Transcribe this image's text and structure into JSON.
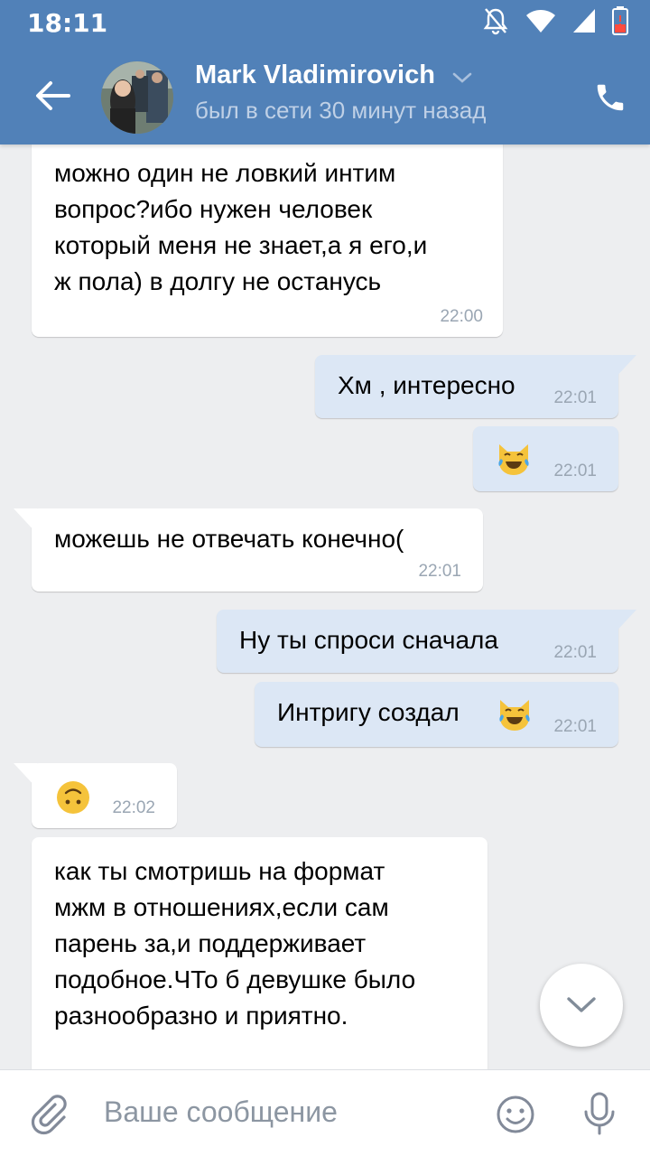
{
  "status_bar": {
    "time": "18:11"
  },
  "header": {
    "contact_name": "Mark Vladimirovich",
    "last_seen": "был в сети 30 минут назад",
    "icons": {
      "back": "back-arrow-icon",
      "call": "phone-icon",
      "dropdown": "chevron-down-icon"
    }
  },
  "messages": [
    {
      "direction": "incoming",
      "text": "можно один не ловкий интим\nвопрос?ибо нужен человек\nкоторый меня не знает,а я его,и\nж пола) в долгу не останусь",
      "time": "22:00"
    },
    {
      "direction": "outgoing",
      "text": "Хм , интересно",
      "time": "22:01"
    },
    {
      "direction": "outgoing",
      "emoji": "cat-tears-of-joy",
      "time": "22:01"
    },
    {
      "direction": "incoming",
      "text": "можешь не отвечать конечно(",
      "time": "22:01"
    },
    {
      "direction": "outgoing",
      "text": "Ну ты спроси сначала",
      "time": "22:01"
    },
    {
      "direction": "outgoing",
      "text": "Интригу создал",
      "emoji": "cat-tears-of-joy",
      "time": "22:01"
    },
    {
      "direction": "incoming",
      "emoji": "upside-down-face",
      "time": "22:02"
    },
    {
      "direction": "incoming",
      "text": "как ты смотришь на формат\nмжм в отношениях,если сам\nпарень за,и поддерживает\nподобное.ЧТо б девушке было\nразнообразно и приятно."
    }
  ],
  "composer": {
    "placeholder": "Ваше сообщение"
  },
  "colors": {
    "header": "#5181b8",
    "background": "#edeef0",
    "outgoing_bubble": "#dce7f5",
    "incoming_bubble": "#ffffff",
    "time": "#9aa6b3"
  }
}
